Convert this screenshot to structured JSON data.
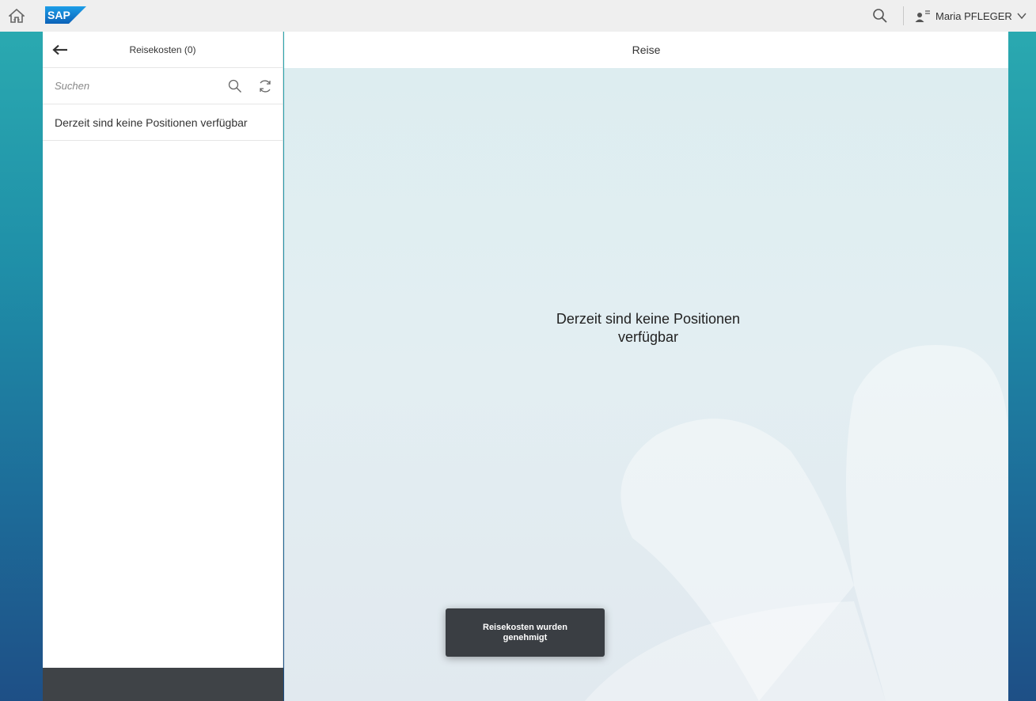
{
  "shell": {
    "logo_text": "SAP",
    "user_name": "Maria PFLEGER",
    "icons": {
      "home": "home-icon",
      "search": "search-icon",
      "user": "user-icon",
      "chevron": "chevron-down-icon"
    }
  },
  "master": {
    "title": "Reisekosten (0)",
    "search_placeholder": "Suchen",
    "empty_text": "Derzeit sind keine Positionen verfügbar"
  },
  "detail": {
    "title": "Reise",
    "empty_line1": "Derzeit sind keine Positionen",
    "empty_line2": "verfügbar"
  },
  "toast": {
    "line1": "Reisekosten wurden",
    "line2": "genehmigt"
  },
  "colors": {
    "accent_dark": "#3f4347",
    "brand_blue": "#1a73c6"
  }
}
